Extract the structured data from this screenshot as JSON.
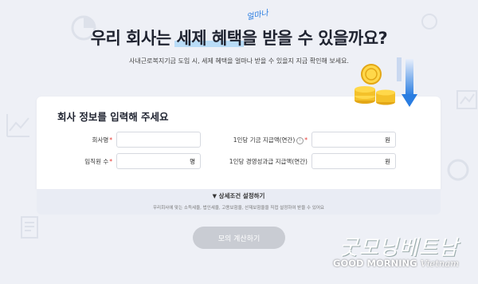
{
  "headline": {
    "part1": "우리 회사는 ",
    "highlight": "세제 혜택",
    "part2": "을 받을 수 있을까요?",
    "scribble": "얼마나"
  },
  "subtitle": "사내근로복지기금 도입 시, 세제 혜택을 얼마나 받을 수 있을지 지금 확인해 보세요.",
  "form": {
    "title": "회사 정보를 입력해 주세요",
    "company_name_label": "회사명",
    "company_name_value": "",
    "employees_label": "임직원 수",
    "employees_unit": "명",
    "fund_label": "1인당 기금 지급액(연간)",
    "fund_unit": "원",
    "bonus_label": "1인당 경영성과급 지급액(연간)",
    "bonus_unit": "원",
    "required_mark": "*",
    "info_glyph": "i"
  },
  "detail": {
    "toggle": "상세조건 설정하기",
    "toggle_icon": "chevron-down-icon",
    "note": "우리회사에 맞는 소득세율, 법인세율, 고용보험율, 산재보험율을 직접 설정하여 받을 수 있어요"
  },
  "calc_button": "모의 계산하기",
  "watermark": {
    "korean": "굿모닝베트남",
    "english_1": "GOOD MORNING",
    "english_2": "Vietnam"
  },
  "colors": {
    "background": "#eef0f6",
    "highlight": "#b9dcf7",
    "required": "#e5322d",
    "button_disabled": "#c9ccd3",
    "accent_blue": "#2a7de1"
  }
}
